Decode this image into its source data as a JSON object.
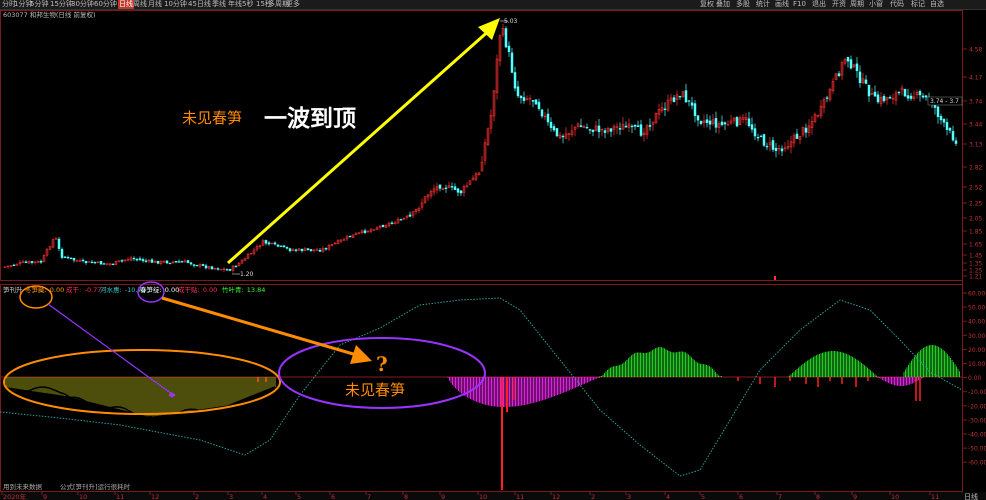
{
  "toolbar": {
    "left_items": [
      "分时",
      "1分钟",
      "5分钟",
      "15分钟",
      "30分钟",
      "60分钟",
      "日线",
      "周线",
      "月线",
      "10分钟",
      "45日线",
      "季线",
      "年线",
      "5秒",
      "15秒",
      "多周期",
      "更多"
    ],
    "active_index": 6,
    "right_items": [
      "复权",
      "叠加",
      "多股",
      "统计",
      "画线",
      "F10",
      "退出",
      "开资",
      "周期",
      "小窗",
      "代码",
      "标记",
      "自选"
    ]
  },
  "stock": {
    "title": "603077 和邦生物(日线 前复权)"
  },
  "price_axis": [
    "4.58",
    "4.17",
    "3.74",
    "3.44",
    "3.13",
    "2.82",
    "2.52",
    "2.25",
    "2.05",
    "1.85",
    "1.65",
    "1.45",
    "1.35",
    "1.25",
    "1.21"
  ],
  "price_labels": {
    "high": "5.03",
    "low": "1.20",
    "price_tag": "3.74 - 3.7"
  },
  "indicator": {
    "name": "笋刊升",
    "fields": [
      {
        "label": "冬笋藏:",
        "value": "0.00",
        "color": "#ff9900"
      },
      {
        "label": "成干:",
        "value": "-0.77",
        "color": "#ff3355"
      },
      {
        "label": "河水惠:",
        "value": "-10.72",
        "color": "#33cccc"
      },
      {
        "label": "春笋绽:",
        "value": "0.00",
        "color": "#ffffff"
      },
      {
        "label": "成干贴:",
        "value": "0.00",
        "color": "#ff3355"
      },
      {
        "label": "竹叶青:",
        "value": "13.84",
        "color": "#33ff33"
      }
    ]
  },
  "indicator_axis": [
    "60.00",
    "50.00",
    "40.00",
    "30.00",
    "20.00",
    "10.00",
    "0.00",
    "-10.00",
    "-20.00",
    "-30.00",
    "-40.00",
    "-50.00",
    "-60.00"
  ],
  "annotations": {
    "headline_small": "未见春笋",
    "headline_big": "一波到顶",
    "question": "?",
    "bubble_text": "未见春笋"
  },
  "date_axis": [
    "2020年",
    "9",
    "10",
    "11",
    "12",
    "2",
    "3",
    "4",
    "5",
    "6",
    "7",
    "8",
    "9",
    "10",
    "11",
    "12",
    "2",
    "3",
    "4",
    "5",
    "6",
    "7",
    "8",
    "9",
    "10",
    "11"
  ],
  "footer": [
    "用到未来数据",
    "公式[笋刊升]运行很耗时"
  ],
  "bottom_right": "日线",
  "colors": {
    "up": "#ff3232",
    "down": "#54ffff",
    "yellow_arrow": "#ffff00",
    "orange": "#ff8c00",
    "purple": "#9933ff"
  }
}
